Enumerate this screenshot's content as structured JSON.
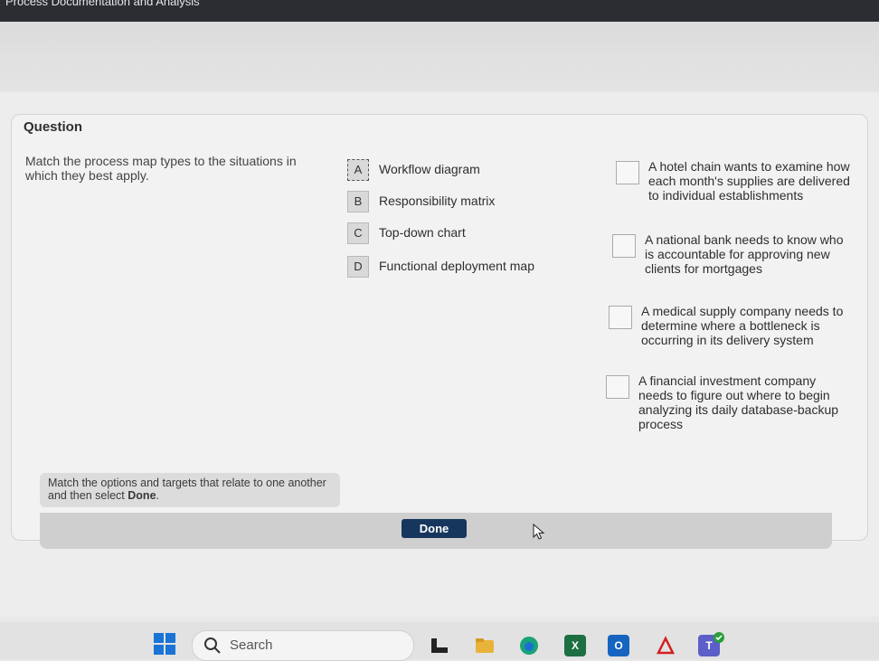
{
  "window": {
    "title": "Process Documentation and Analysis"
  },
  "question": {
    "heading": "Question",
    "prompt": "Match the process map types to the situations in which they best apply.",
    "options": [
      {
        "letter": "A",
        "label": "Workflow diagram"
      },
      {
        "letter": "B",
        "label": "Responsibility matrix"
      },
      {
        "letter": "C",
        "label": "Top-down chart"
      },
      {
        "letter": "D",
        "label": "Functional deployment map"
      }
    ],
    "targets": [
      {
        "text": "A hotel chain wants to examine how each month's supplies are delivered to individual establishments"
      },
      {
        "text": "A national bank needs to know who is accountable for approving new clients for mortgages"
      },
      {
        "text": "A medical supply company needs to determine where a bottleneck is occurring in its delivery system"
      },
      {
        "text": "A financial investment company needs to figure out where to begin analyzing its daily database-backup process"
      }
    ],
    "hint_prefix": "Match the options and targets that relate to one another and then select ",
    "hint_bold": "Done",
    "hint_suffix": ".",
    "done_label": "Done"
  },
  "taskbar": {
    "search_label": "Search",
    "icons": [
      "windows-start-icon",
      "file-explorer-icon",
      "folder-icon",
      "edge-icon",
      "excel-icon",
      "outlook-icon",
      "acrobat-icon",
      "teams-icon"
    ]
  },
  "colors": {
    "done_button": "#17365e",
    "accent_blue": "#1a73d6"
  }
}
